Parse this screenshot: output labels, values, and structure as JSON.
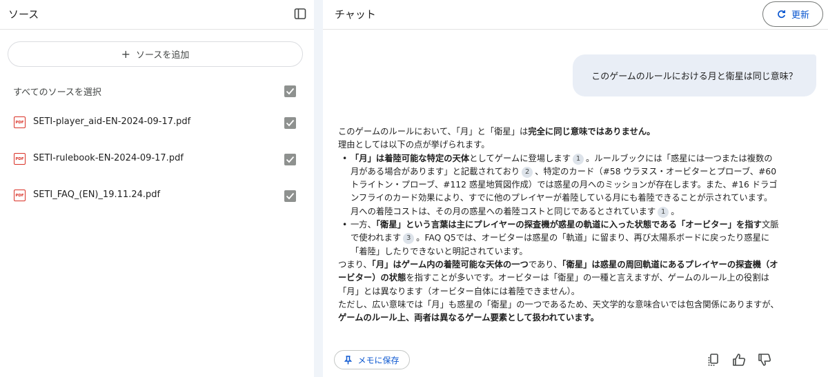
{
  "sources_panel": {
    "title": "ソース",
    "add_button": {
      "icon": "plus-icon",
      "label": "ソースを追加"
    },
    "select_all_label": "すべてのソースを選択",
    "items": [
      {
        "icon": "pdf-icon",
        "icon_text": "PDF",
        "name": "SETI-player_aid-EN-2024-09-17.pdf",
        "checked": true
      },
      {
        "icon": "pdf-icon",
        "icon_text": "PDF",
        "name": "SETI-rulebook-EN-2024-09-17.pdf",
        "checked": true
      },
      {
        "icon": "pdf-icon",
        "icon_text": "PDF",
        "name": "SETI_FAQ_(EN)_19.11.24.pdf",
        "checked": true
      }
    ]
  },
  "chat_panel": {
    "title": "チャット",
    "refresh_button": {
      "icon": "refresh-icon",
      "label": "更新"
    },
    "user_message": "このゲームのルールにおける月と衛星は同じ意味？",
    "answer": {
      "intro_a": "このゲームのルールにおいて、「月」と「衛星」は",
      "intro_b": "完全に同じ意味ではありません。",
      "reasons_lead": "理由としては以下の点が挙げられます。",
      "bullet1": {
        "bold": "「月」は着陸可能な特定の天体",
        "t1": "としてゲームに登場します",
        "c1": "1",
        "t2": "。ルールブックには「惑星には一つまたは複数の月がある場合があります」と記載されており",
        "c2": "2",
        "t3": "、特定のカード（#58 ウラヌス・オービターとプローブ、#60 トライトン・プローブ、#112 惑星地質図作成）では惑星の月へのミッションが存在します。また、#16 ドラゴンフライのカード効果により、すでに他のプレイヤーが着陸している月にも着陸できることが示されています。月への着陸コストは、その月の惑星への着陸コストと同じであるとされています",
        "c3": "1",
        "t4": "。"
      },
      "bullet2": {
        "t1": "一方、",
        "bold": "「衛星」という言葉は主にプレイヤーの探査機が惑星の軌道に入った状態である「オービター」を指す",
        "t2": "文脈で使われます",
        "c1": "3",
        "t3": "。FAQ Q5では、オービターは惑星の「軌道」に留まり、再び太陽系ボードに戻ったり惑星に「着陸」したりできないと明記されています。"
      },
      "conclusion": {
        "t1": "つまり、",
        "b1": "「月」はゲーム内の着陸可能な天体の一つ",
        "t2": "であり、",
        "b2": "「衛星」は惑星の周回軌道にあるプレイヤーの探査機（オービター）の状態",
        "t3": "を指すことが多いです。オービターは「衛星」の一種と言えますが、ゲームのルール上の役割は「月」とは異なります（オービター自体には着陸できません）。"
      },
      "caveat": {
        "t1": "ただし、広い意味では「月」も惑星の「衛星」の一つであるため、天文学的な意味合いでは包含関係にありますが、",
        "b1": "ゲームのルール上、両者は異なるゲーム要素として扱われています。"
      }
    },
    "save_note_button": {
      "icon": "pin-icon",
      "label": "メモに保存"
    },
    "actions": [
      "copy-icon",
      "thumbs-up-icon",
      "thumbs-down-icon"
    ],
    "colors": {
      "accent": "#0b57d0",
      "pdf": "#d93025",
      "bubble": "#e9eef6",
      "divider": "#f0f4f9"
    }
  }
}
